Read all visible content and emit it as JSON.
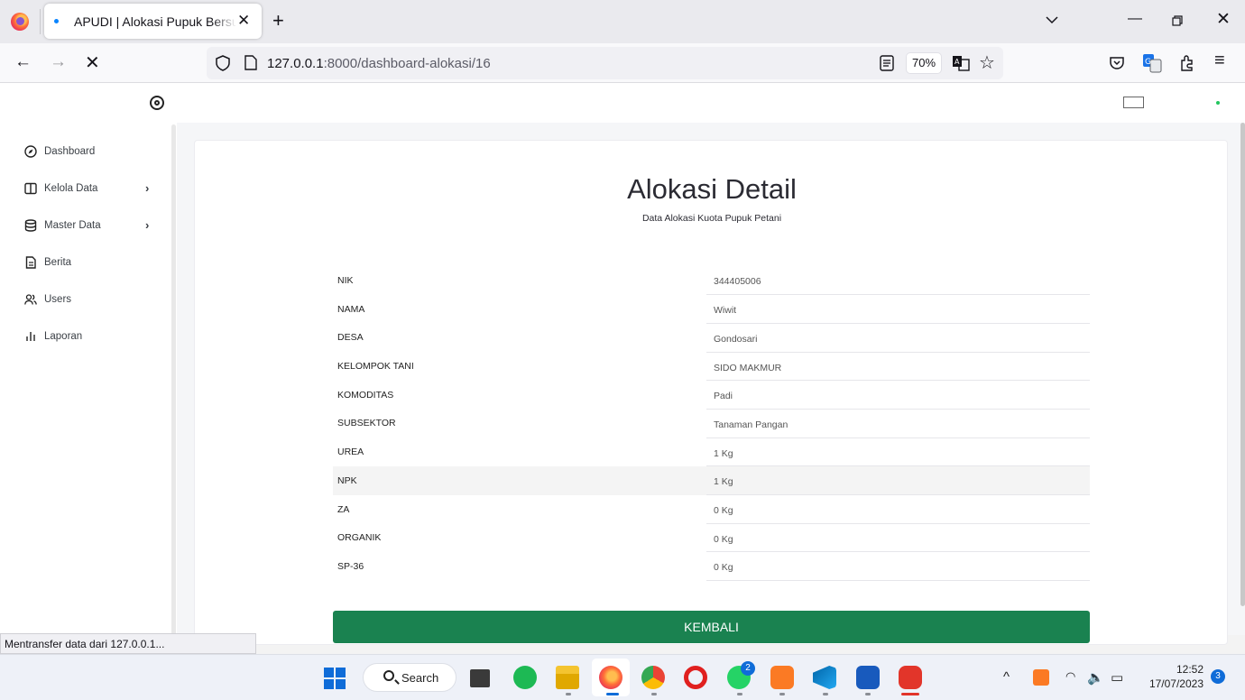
{
  "browser": {
    "tab_title": "APUDI | Alokasi Pupuk Bersubsidi",
    "url_host": "127.0.0.1",
    "url_rest": ":8000/dashboard-alokasi/16",
    "zoom": "70%",
    "status_text": "Mentransfer data dari 127.0.0.1..."
  },
  "sidebar": {
    "items": [
      {
        "label": "Dashboard",
        "icon": "compass-icon"
      },
      {
        "label": "Kelola Data",
        "icon": "columns-icon"
      },
      {
        "label": "Master Data",
        "icon": "database-icon"
      },
      {
        "label": "Berita",
        "icon": "document-icon"
      },
      {
        "label": "Users",
        "icon": "users-icon"
      },
      {
        "label": "Laporan",
        "icon": "bar-chart-icon"
      }
    ]
  },
  "main": {
    "title": "Alokasi Detail",
    "subtitle": "Data Alokasi Kuota Pupuk Petani",
    "rows": [
      {
        "key": "NIK",
        "value": "344405006"
      },
      {
        "key": "NAMA",
        "value": "Wiwit"
      },
      {
        "key": "DESA",
        "value": "Gondosari"
      },
      {
        "key": "KELOMPOK TANI",
        "value": "SIDO MAKMUR"
      },
      {
        "key": "KOMODITAS",
        "value": "Padi"
      },
      {
        "key": "SUBSEKTOR",
        "value": "Tanaman Pangan"
      },
      {
        "key": "UREA",
        "value": "1 Kg"
      },
      {
        "key": "NPK",
        "value": "1 Kg"
      },
      {
        "key": "ZA",
        "value": "0 Kg"
      },
      {
        "key": "ORGANIK",
        "value": "0 Kg"
      },
      {
        "key": "SP-36",
        "value": "0 Kg"
      }
    ],
    "back_label": "KEMBALI",
    "accent_color": "#1a8250"
  },
  "taskbar": {
    "search_label": "Search",
    "whatsapp_badge": "2",
    "time": "12:52",
    "date": "17/07/2023",
    "notification_count": "3"
  }
}
